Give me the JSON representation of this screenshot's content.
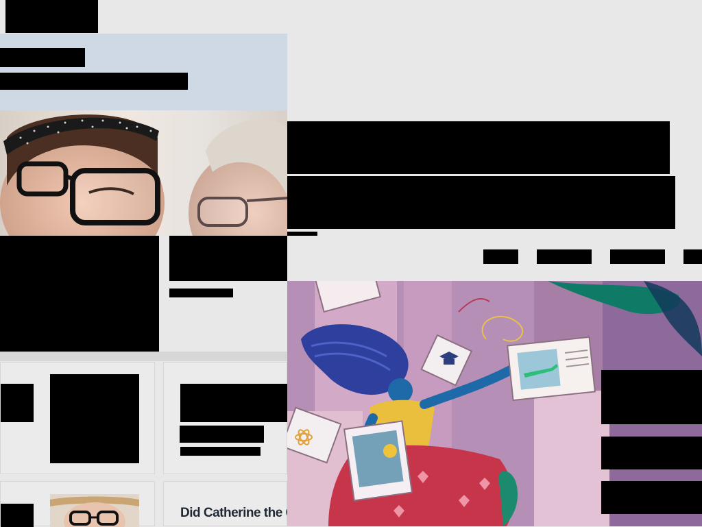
{
  "list": {
    "card_4_title": "Did Catherine the G"
  }
}
